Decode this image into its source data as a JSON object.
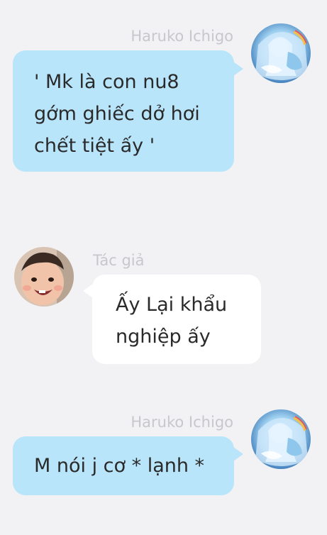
{
  "messages": [
    {
      "sender": "Haruko Ichigo",
      "side": "right",
      "avatar": "anime-girl-avatar",
      "lines": [
        "' Mk là con nu8",
        "gớm ghiếc dở hơi",
        "chết tiệt ấy '"
      ]
    },
    {
      "sender": "Tác giả",
      "side": "left",
      "avatar": "baby-photo-avatar",
      "lines": [
        "Ấy Lại khẩu",
        "nghiệp ấy"
      ]
    },
    {
      "sender": "Haruko Ichigo",
      "side": "right",
      "avatar": "anime-girl-avatar",
      "lines": [
        "M nói j cơ * lạnh *"
      ]
    }
  ],
  "colors": {
    "background": "#f2f2f4",
    "bubble_blue": "#b9e5fb",
    "bubble_white": "#ffffff",
    "sender_name": "#c7c7cc",
    "text": "#2a2a2a"
  }
}
